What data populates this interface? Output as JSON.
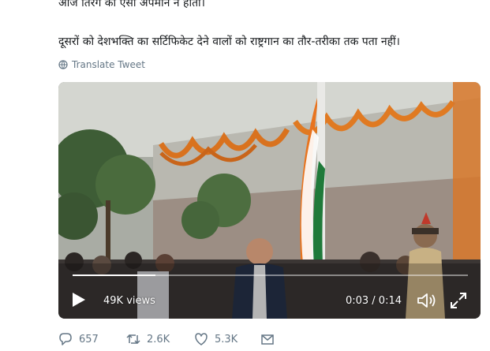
{
  "tweet": {
    "line1": "आज तिरंगे का ऐसा अपमान न होता।",
    "line2": "दूसरों को देशभक्ति का सर्टिफिकेट देने वालों को राष्ट्रगान का तौर-तरीका तक पता नहीं।",
    "translate_label": "Translate Tweet"
  },
  "video": {
    "views": "49K views",
    "time": "0:03 / 0:14",
    "progress": 0.21
  },
  "actions": {
    "replies": "657",
    "retweets": "2.6K",
    "likes": "5.3K"
  },
  "colors": {
    "text": "#14171a",
    "muted": "#657786",
    "saffron": "#e8741f",
    "flag_green": "#1f7a3a"
  },
  "icons": [
    "globe-icon",
    "play-icon",
    "volume-icon",
    "fullscreen-icon",
    "reply-icon",
    "retweet-icon",
    "like-icon",
    "dm-icon"
  ]
}
